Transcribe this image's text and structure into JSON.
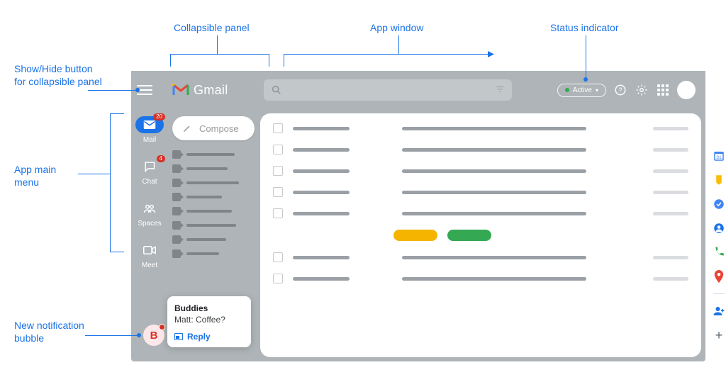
{
  "annotations": {
    "hamburger": "Show/Hide button for collapsible panel",
    "panel": "Collapsible panel",
    "window": "App window",
    "status": "Status indicator",
    "menu": "App main menu",
    "notif": "New notification bubble"
  },
  "header": {
    "product": "Gmail",
    "search_placeholder": "",
    "status_label": "Active"
  },
  "rail": {
    "items": [
      {
        "label": "Mail",
        "badge": "20",
        "selected": true
      },
      {
        "label": "Chat",
        "badge": "4",
        "selected": false
      },
      {
        "label": "Spaces",
        "badge": "",
        "selected": false
      },
      {
        "label": "Meet",
        "badge": "",
        "selected": false
      }
    ]
  },
  "panel": {
    "compose_label": "Compose",
    "folder_count": 8
  },
  "sideapps": {
    "items": [
      "calendar",
      "keep",
      "tasks",
      "contacts",
      "voice",
      "maps"
    ]
  },
  "notification": {
    "avatar_letter": "B",
    "title": "Buddies",
    "message": "Matt: Coffee?",
    "reply_label": "Reply"
  },
  "colors": {
    "brand_blue": "#1a73e8",
    "green": "#34a853",
    "yellow": "#f4b400",
    "red": "#d93025",
    "panel_bg": "#aeb4b7"
  }
}
